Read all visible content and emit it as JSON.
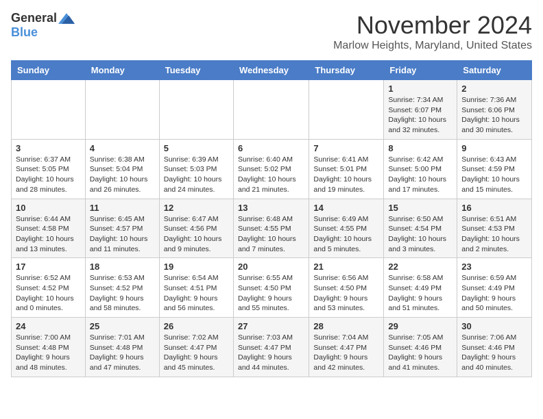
{
  "logo": {
    "general": "General",
    "blue": "Blue"
  },
  "header": {
    "month": "November 2024",
    "location": "Marlow Heights, Maryland, United States"
  },
  "weekdays": [
    "Sunday",
    "Monday",
    "Tuesday",
    "Wednesday",
    "Thursday",
    "Friday",
    "Saturday"
  ],
  "weeks": [
    [
      {
        "day": "",
        "info": ""
      },
      {
        "day": "",
        "info": ""
      },
      {
        "day": "",
        "info": ""
      },
      {
        "day": "",
        "info": ""
      },
      {
        "day": "",
        "info": ""
      },
      {
        "day": "1",
        "info": "Sunrise: 7:34 AM\nSunset: 6:07 PM\nDaylight: 10 hours and 32 minutes."
      },
      {
        "day": "2",
        "info": "Sunrise: 7:36 AM\nSunset: 6:06 PM\nDaylight: 10 hours and 30 minutes."
      }
    ],
    [
      {
        "day": "3",
        "info": "Sunrise: 6:37 AM\nSunset: 5:05 PM\nDaylight: 10 hours and 28 minutes."
      },
      {
        "day": "4",
        "info": "Sunrise: 6:38 AM\nSunset: 5:04 PM\nDaylight: 10 hours and 26 minutes."
      },
      {
        "day": "5",
        "info": "Sunrise: 6:39 AM\nSunset: 5:03 PM\nDaylight: 10 hours and 24 minutes."
      },
      {
        "day": "6",
        "info": "Sunrise: 6:40 AM\nSunset: 5:02 PM\nDaylight: 10 hours and 21 minutes."
      },
      {
        "day": "7",
        "info": "Sunrise: 6:41 AM\nSunset: 5:01 PM\nDaylight: 10 hours and 19 minutes."
      },
      {
        "day": "8",
        "info": "Sunrise: 6:42 AM\nSunset: 5:00 PM\nDaylight: 10 hours and 17 minutes."
      },
      {
        "day": "9",
        "info": "Sunrise: 6:43 AM\nSunset: 4:59 PM\nDaylight: 10 hours and 15 minutes."
      }
    ],
    [
      {
        "day": "10",
        "info": "Sunrise: 6:44 AM\nSunset: 4:58 PM\nDaylight: 10 hours and 13 minutes."
      },
      {
        "day": "11",
        "info": "Sunrise: 6:45 AM\nSunset: 4:57 PM\nDaylight: 10 hours and 11 minutes."
      },
      {
        "day": "12",
        "info": "Sunrise: 6:47 AM\nSunset: 4:56 PM\nDaylight: 10 hours and 9 minutes."
      },
      {
        "day": "13",
        "info": "Sunrise: 6:48 AM\nSunset: 4:55 PM\nDaylight: 10 hours and 7 minutes."
      },
      {
        "day": "14",
        "info": "Sunrise: 6:49 AM\nSunset: 4:55 PM\nDaylight: 10 hours and 5 minutes."
      },
      {
        "day": "15",
        "info": "Sunrise: 6:50 AM\nSunset: 4:54 PM\nDaylight: 10 hours and 3 minutes."
      },
      {
        "day": "16",
        "info": "Sunrise: 6:51 AM\nSunset: 4:53 PM\nDaylight: 10 hours and 2 minutes."
      }
    ],
    [
      {
        "day": "17",
        "info": "Sunrise: 6:52 AM\nSunset: 4:52 PM\nDaylight: 10 hours and 0 minutes."
      },
      {
        "day": "18",
        "info": "Sunrise: 6:53 AM\nSunset: 4:52 PM\nDaylight: 9 hours and 58 minutes."
      },
      {
        "day": "19",
        "info": "Sunrise: 6:54 AM\nSunset: 4:51 PM\nDaylight: 9 hours and 56 minutes."
      },
      {
        "day": "20",
        "info": "Sunrise: 6:55 AM\nSunset: 4:50 PM\nDaylight: 9 hours and 55 minutes."
      },
      {
        "day": "21",
        "info": "Sunrise: 6:56 AM\nSunset: 4:50 PM\nDaylight: 9 hours and 53 minutes."
      },
      {
        "day": "22",
        "info": "Sunrise: 6:58 AM\nSunset: 4:49 PM\nDaylight: 9 hours and 51 minutes."
      },
      {
        "day": "23",
        "info": "Sunrise: 6:59 AM\nSunset: 4:49 PM\nDaylight: 9 hours and 50 minutes."
      }
    ],
    [
      {
        "day": "24",
        "info": "Sunrise: 7:00 AM\nSunset: 4:48 PM\nDaylight: 9 hours and 48 minutes."
      },
      {
        "day": "25",
        "info": "Sunrise: 7:01 AM\nSunset: 4:48 PM\nDaylight: 9 hours and 47 minutes."
      },
      {
        "day": "26",
        "info": "Sunrise: 7:02 AM\nSunset: 4:47 PM\nDaylight: 9 hours and 45 minutes."
      },
      {
        "day": "27",
        "info": "Sunrise: 7:03 AM\nSunset: 4:47 PM\nDaylight: 9 hours and 44 minutes."
      },
      {
        "day": "28",
        "info": "Sunrise: 7:04 AM\nSunset: 4:47 PM\nDaylight: 9 hours and 42 minutes."
      },
      {
        "day": "29",
        "info": "Sunrise: 7:05 AM\nSunset: 4:46 PM\nDaylight: 9 hours and 41 minutes."
      },
      {
        "day": "30",
        "info": "Sunrise: 7:06 AM\nSunset: 4:46 PM\nDaylight: 9 hours and 40 minutes."
      }
    ]
  ]
}
